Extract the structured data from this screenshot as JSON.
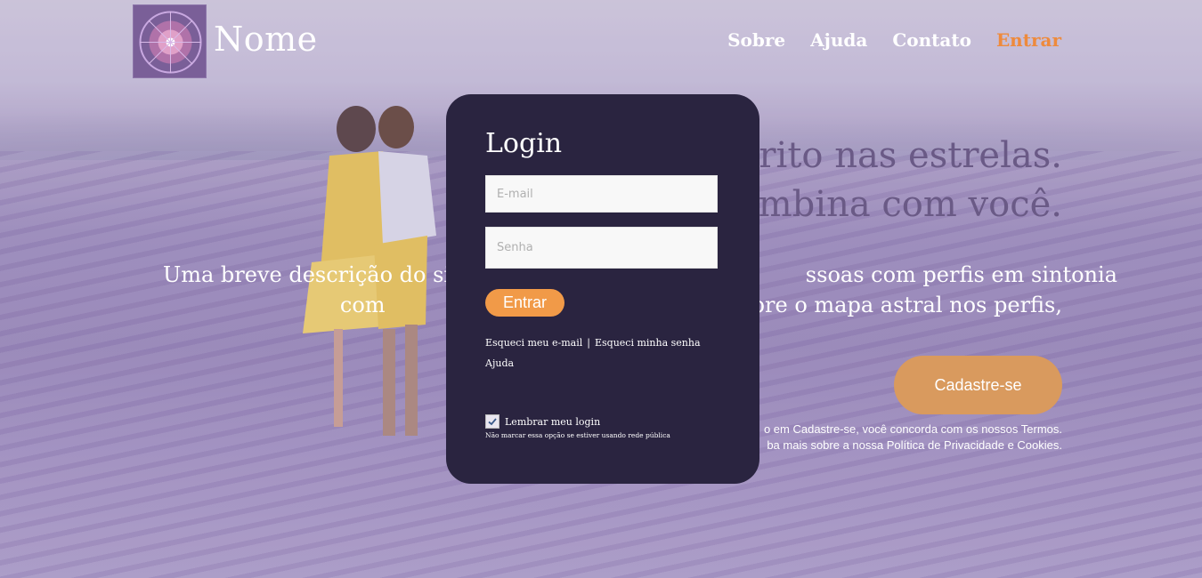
{
  "header": {
    "brand": "Nome",
    "nav": [
      {
        "label": "Sobre",
        "active": false
      },
      {
        "label": "Ajuda",
        "active": false
      },
      {
        "label": "Contato",
        "active": false
      },
      {
        "label": "Entrar",
        "active": true
      }
    ]
  },
  "hero": {
    "title_line1": "crito nas estrelas.",
    "title_line2": "ombina com você.",
    "desc_line1": "Uma breve descrição do sit                                                   ssoas com perfis em sintonia",
    "desc_line2": "com                                                    obre o mapa astral nos perfis,",
    "cta_label": "Cadastre-se",
    "terms_line1": "o em Cadastre-se, você concorda com os nossos Termos.",
    "terms_line2": "ba mais sobre a nossa Política de Privacidade e Cookies."
  },
  "login": {
    "title": "Login",
    "email_placeholder": "E-mail",
    "password_placeholder": "Senha",
    "submit_label": "Entrar",
    "forgot_email": "Esqueci meu e-mail",
    "separator": "|",
    "forgot_password": "Esqueci minha senha",
    "help": "Ajuda",
    "remember_label": "Lembrar meu login",
    "remember_checked": true,
    "remember_hint": "Não marcar essa opção se estiver usando rede pública"
  },
  "colors": {
    "accent": "#ee8a3c",
    "modal_bg": "#2a2440",
    "button": "#f19a48"
  }
}
